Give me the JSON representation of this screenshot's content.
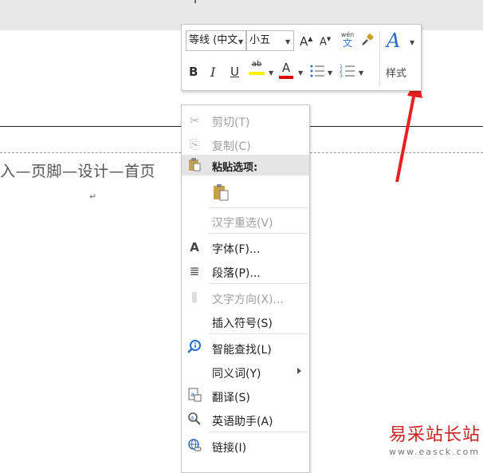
{
  "doc": {
    "body_text": "入—页脚—设计—首页",
    "para_mark": "↵"
  },
  "mini_toolbar": {
    "font_family": "等线 (中文",
    "font_size": "小五",
    "grow_glyph": "A",
    "shrink_glyph": "A",
    "phonetic_top": "wén",
    "phonetic_bottom": "文",
    "bold": "B",
    "italic": "I",
    "underline": "U",
    "highlight_glyph": "ab",
    "font_color_glyph": "A",
    "styles_glyph": "A",
    "styles_label": "样式",
    "highlight_color": "#ffef00",
    "font_color": "#e00000"
  },
  "context_menu": {
    "cut": "剪切(T)",
    "copy": "复制(C)",
    "paste_options": "粘贴选项:",
    "reconvert": "汉字重选(V)",
    "font": "字体(F)...",
    "paragraph": "段落(P)...",
    "text_direction": "文字方向(X)...",
    "insert_symbol": "插入符号(S)",
    "smart_lookup": "智能查找(L)",
    "synonyms": "同义词(Y)",
    "translate": "翻译(S)",
    "english_assistant": "英语助手(A)",
    "link": "链接(I)",
    "font_icon": "A"
  },
  "watermark": {
    "brand": "易采站长站",
    "url": "www.easck.com"
  }
}
